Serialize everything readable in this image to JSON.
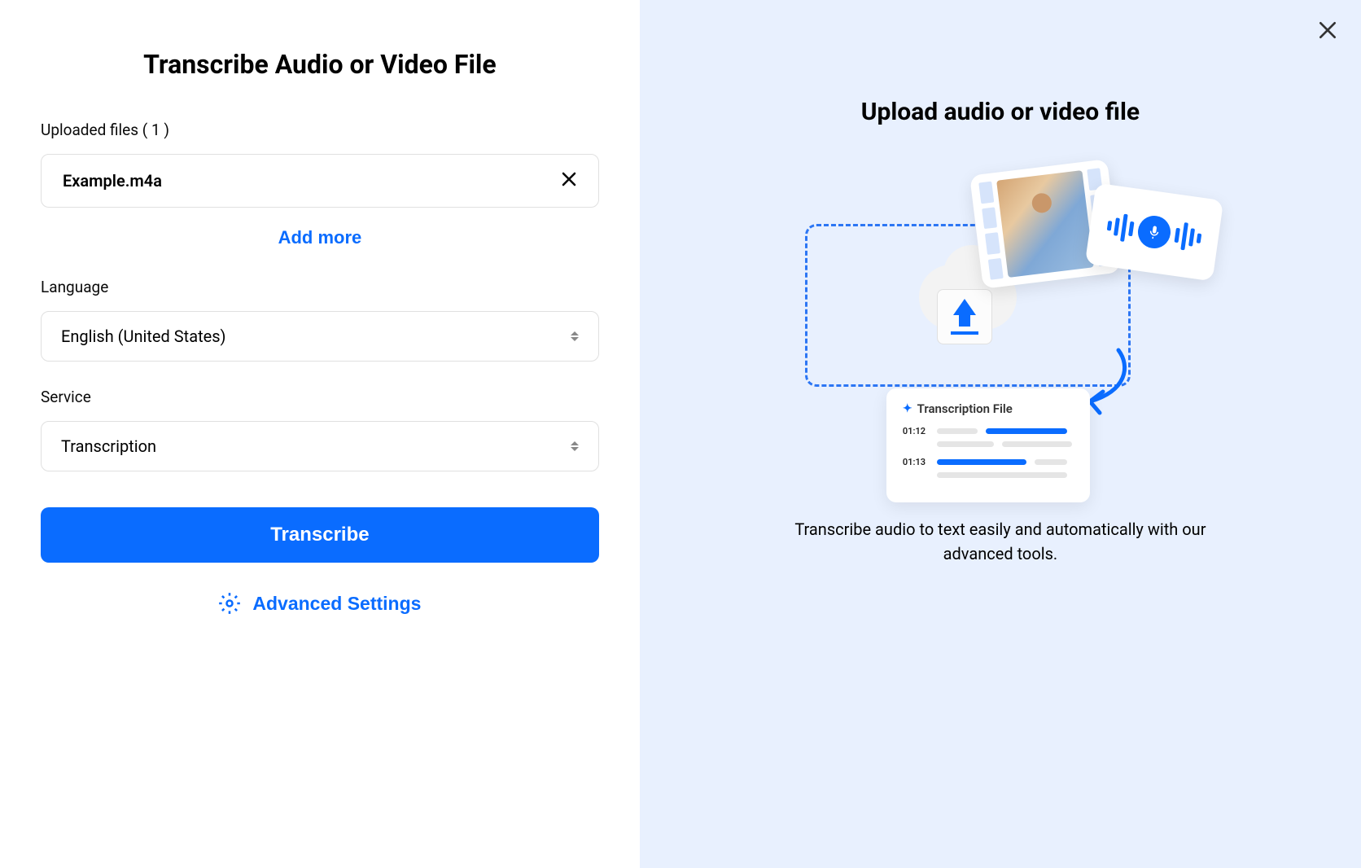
{
  "left": {
    "heading": "Transcribe Audio or Video File",
    "uploadedLabel": "Uploaded files ( 1 )",
    "files": [
      {
        "name": "Example.m4a"
      }
    ],
    "addMore": "Add more",
    "languageLabel": "Language",
    "languageValue": "English (United States)",
    "serviceLabel": "Service",
    "serviceValue": "Transcription",
    "transcribeButton": "Transcribe",
    "advancedSettings": "Advanced Settings"
  },
  "right": {
    "heading": "Upload audio or video file",
    "illustration": {
      "transcriptionTitle": "Transcription File",
      "timestamps": [
        "01:12",
        "01:13"
      ]
    },
    "description": "Transcribe audio to text easily and automatically with our advanced tools."
  }
}
